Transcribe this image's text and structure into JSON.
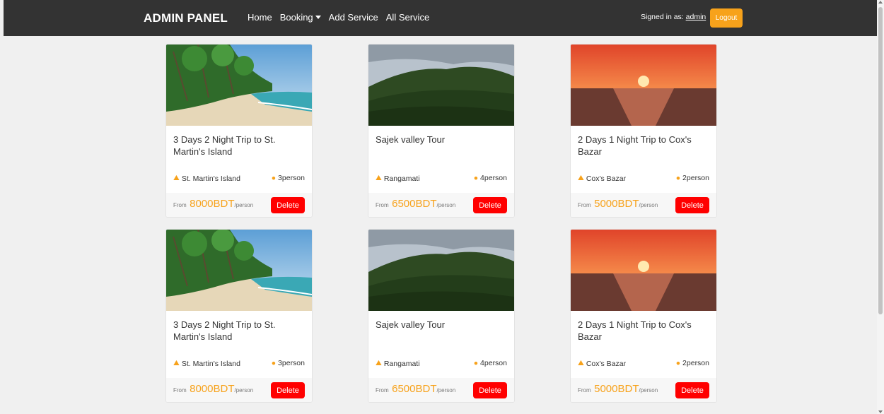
{
  "navbar": {
    "brand": "ADMIN PANEL",
    "links": [
      "Home",
      "Booking",
      "Add Service",
      "All Service"
    ],
    "signed_in_label": "Signed in as:",
    "signed_in_user": "admin",
    "logout_label": "Logout"
  },
  "cards": [
    {
      "title": "3 Days 2 Night Trip to St. Martin's Island",
      "location": "St. Martin's Island",
      "persons": "3person",
      "from": "From",
      "price": "8000BDT",
      "unit": "/person",
      "delete": "Delete",
      "image": "beach"
    },
    {
      "title": "Sajek valley Tour",
      "location": "Rangamati",
      "persons": "4person",
      "from": "From",
      "price": "6500BDT",
      "unit": "/person",
      "delete": "Delete",
      "image": "valley"
    },
    {
      "title": "2 Days 1 Night Trip to Cox's Bazar",
      "location": "Cox's Bazar",
      "persons": "2person",
      "from": "From",
      "price": "5000BDT",
      "unit": "/person",
      "delete": "Delete",
      "image": "sunset"
    },
    {
      "title": "3 Days 2 Night Trip to St. Martin's Island",
      "location": "St. Martin's Island",
      "persons": "3person",
      "from": "From",
      "price": "8000BDT",
      "unit": "/person",
      "delete": "Delete",
      "image": "beach"
    },
    {
      "title": "Sajek valley Tour",
      "location": "Rangamati",
      "persons": "4person",
      "from": "From",
      "price": "6500BDT",
      "unit": "/person",
      "delete": "Delete",
      "image": "valley"
    },
    {
      "title": "2 Days 1 Night Trip to Cox's Bazar",
      "location": "Cox's Bazar",
      "persons": "2person",
      "from": "From",
      "price": "5000BDT",
      "unit": "/person",
      "delete": "Delete",
      "image": "sunset"
    }
  ],
  "colors": {
    "navbar": "#333333",
    "accent": "#f7a21b",
    "delete": "#ff0000"
  },
  "icons": {
    "location": "map-location-icon",
    "person": "person-icon"
  }
}
